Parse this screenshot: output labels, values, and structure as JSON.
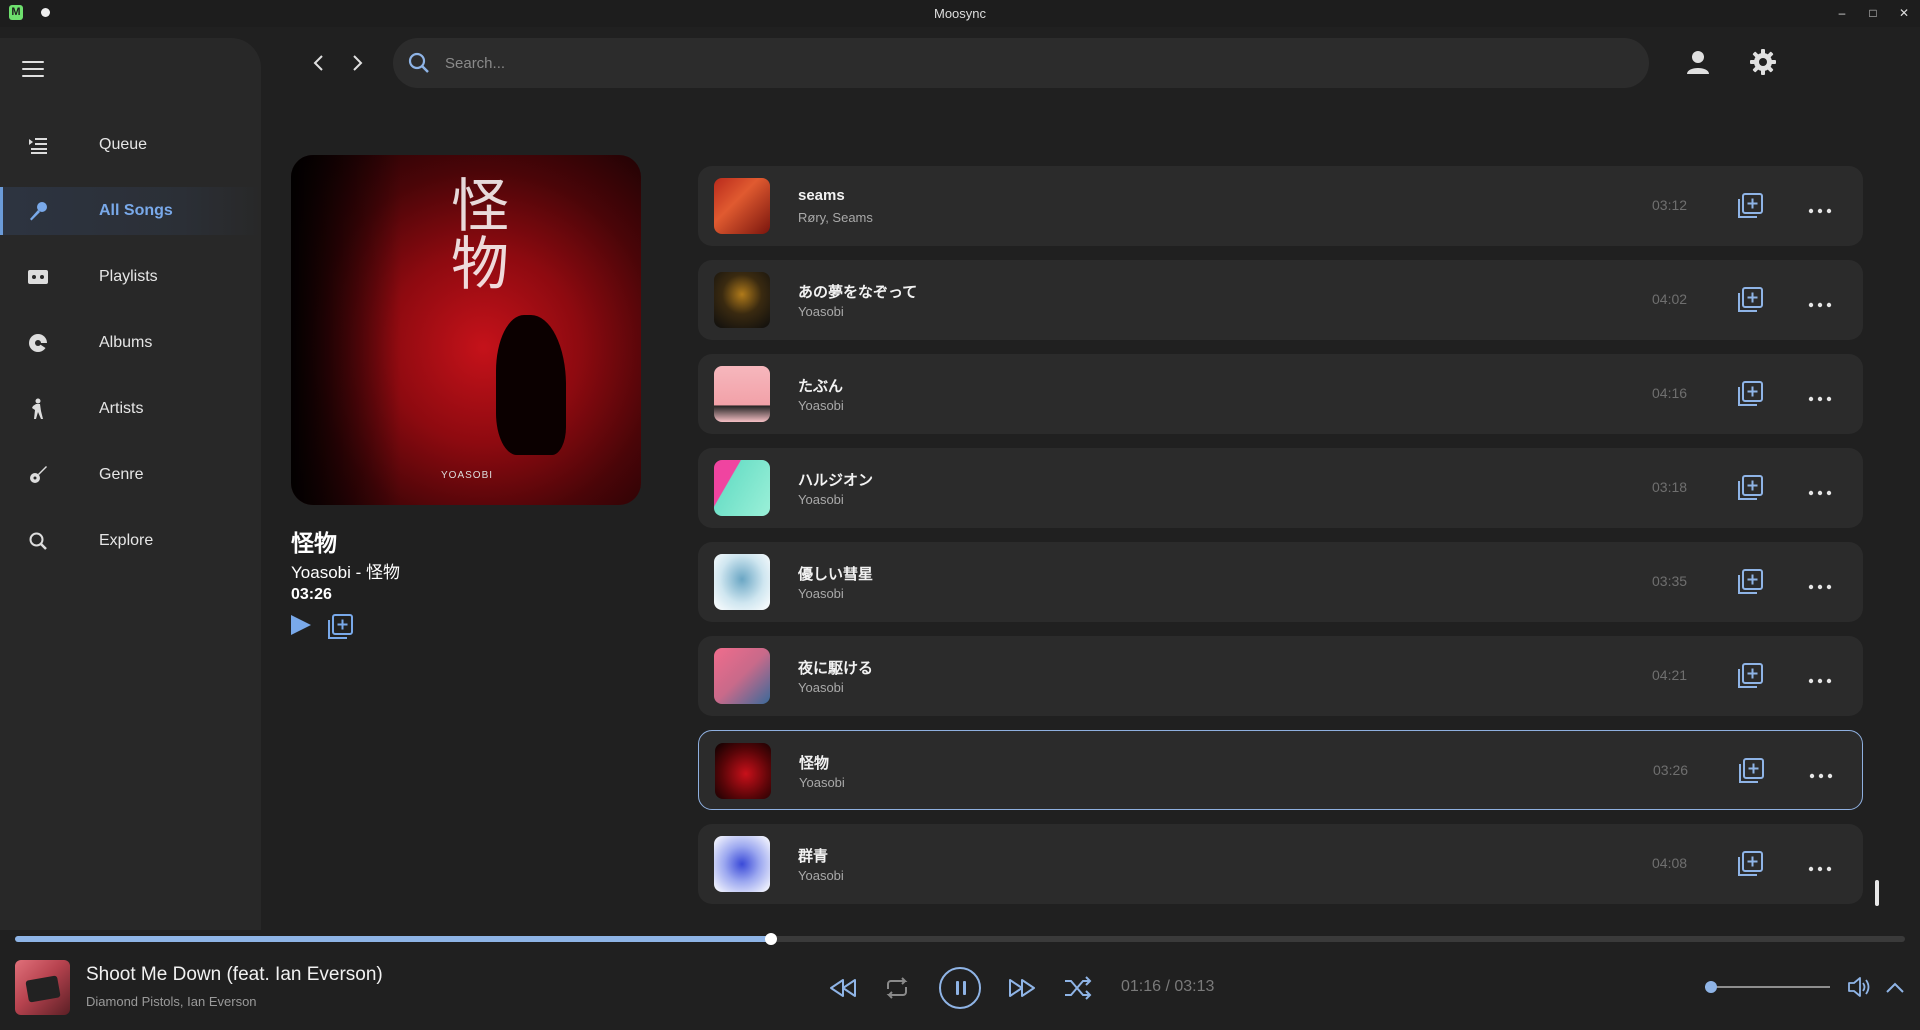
{
  "window": {
    "title": "Moosync",
    "logo_letter": "M",
    "controls": [
      "–",
      "□",
      "✕"
    ]
  },
  "sidebar": {
    "items": [
      {
        "label": "Queue",
        "icon": "queue-icon",
        "active": false
      },
      {
        "label": "All Songs",
        "icon": "microphone-icon",
        "active": true
      },
      {
        "label": "Playlists",
        "icon": "cassette-icon",
        "active": false
      },
      {
        "label": "Albums",
        "icon": "disc-icon",
        "active": false
      },
      {
        "label": "Artists",
        "icon": "person-icon",
        "active": false
      },
      {
        "label": "Genre",
        "icon": "guitar-icon",
        "active": false
      },
      {
        "label": "Explore",
        "icon": "search-icon",
        "active": false
      }
    ]
  },
  "search": {
    "placeholder": "Search..."
  },
  "detail": {
    "title": "怪物",
    "subtitle": "Yoasobi - 怪物",
    "duration": "03:26",
    "album_text": "怪物",
    "album_brand": "YOASOBI"
  },
  "songs": [
    {
      "title": "seams",
      "artist": "Røry, Seams",
      "duration": "03:12"
    },
    {
      "title": "あの夢をなぞって",
      "artist": "Yoasobi",
      "duration": "04:02"
    },
    {
      "title": "たぶん",
      "artist": "Yoasobi",
      "duration": "04:16"
    },
    {
      "title": "ハルジオン",
      "artist": "Yoasobi",
      "duration": "03:18"
    },
    {
      "title": "優しい彗星",
      "artist": "Yoasobi",
      "duration": "03:35"
    },
    {
      "title": "夜に駆ける",
      "artist": "Yoasobi",
      "duration": "04:21"
    },
    {
      "title": "怪物",
      "artist": "Yoasobi",
      "duration": "03:26"
    },
    {
      "title": "群青",
      "artist": "Yoasobi",
      "duration": "04:08"
    }
  ],
  "player": {
    "title": "Shoot Me Down (feat. Ian Everson)",
    "artist": "Diamond Pistols, Ian Everson",
    "time": "01:16 / 03:13",
    "progress": 0.4,
    "volume": 0.05
  },
  "colors": {
    "accent": "#8fb4e6",
    "background": "#202020",
    "sidebar": "#282828",
    "row": "#2b2b2b"
  }
}
